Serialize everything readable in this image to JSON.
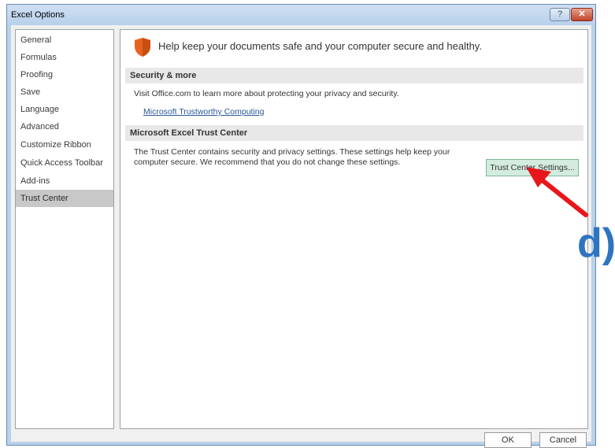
{
  "window": {
    "title": "Excel Options",
    "help_label": "?",
    "close_label": "✕"
  },
  "nav": {
    "items": [
      {
        "label": "General"
      },
      {
        "label": "Formulas"
      },
      {
        "label": "Proofing"
      },
      {
        "label": "Save"
      },
      {
        "label": "Language"
      },
      {
        "label": "Advanced"
      },
      {
        "label": "Customize Ribbon"
      },
      {
        "label": "Quick Access Toolbar"
      },
      {
        "label": "Add-ins"
      },
      {
        "label": "Trust Center"
      }
    ],
    "selected": "Trust Center"
  },
  "main": {
    "header": "Help keep your documents safe and your computer secure and healthy.",
    "security": {
      "title": "Security & more",
      "description": "Visit Office.com to learn more about protecting your privacy and security.",
      "link": "Microsoft Trustworthy Computing"
    },
    "trust_center": {
      "title": "Microsoft Excel Trust Center",
      "line1": "The Trust Center contains security and privacy settings. These settings help keep your",
      "line2": "computer secure. We recommend that you do not change these settings.",
      "button": "Trust Center Settings..."
    }
  },
  "footer": {
    "ok_label": "OK",
    "cancel_label": "Cancel"
  },
  "annotation": {
    "label": "d)",
    "arrow_color": "#e8161b",
    "label_color": "#2f74c0"
  },
  "colors": {
    "shield": "#e8621f",
    "button_highlight": "#d4ecdf"
  }
}
